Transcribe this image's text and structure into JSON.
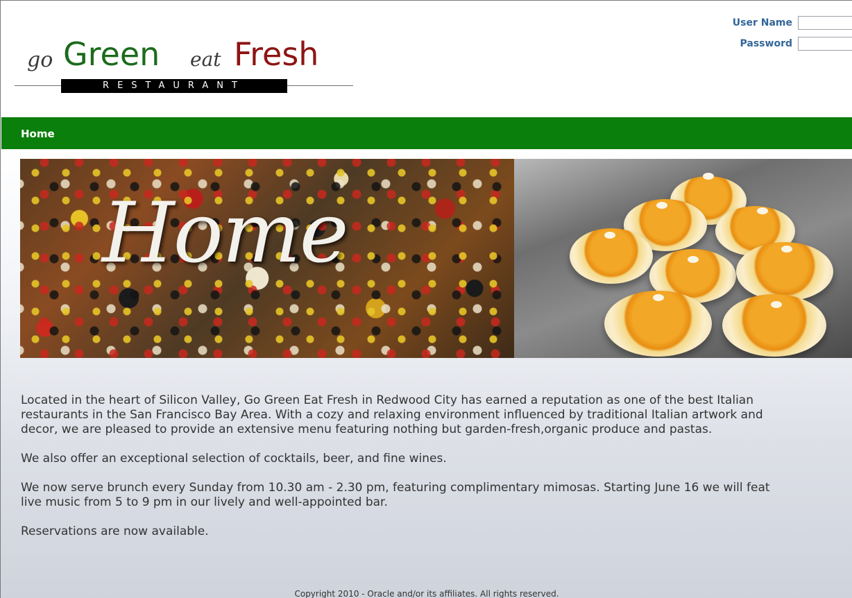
{
  "logo": {
    "go": "go",
    "green": "Green",
    "eat": "eat",
    "fresh": "Fresh",
    "tagline": "RESTAURANT"
  },
  "login": {
    "username_label": "User Name",
    "username_value": "",
    "password_label": "Password",
    "password_value": ""
  },
  "nav": {
    "home": "Home"
  },
  "hero": {
    "title": "Home"
  },
  "content": {
    "paragraphs": [
      [
        "Located in the heart of Silicon Valley, Go Green Eat Fresh in Redwood City has earned a reputation as one of the best Italian",
        "restaurants in the San Francisco Bay Area. With a cozy and relaxing environment influenced by traditional Italian artwork and",
        "decor, we are pleased to provide an extensive menu featuring nothing but garden-fresh,organic produce and pastas."
      ],
      [
        "We also offer an exceptional selection of cocktails, beer, and fine wines."
      ],
      [
        "We now serve brunch every Sunday from 10.30 am - 2.30 pm, featuring complimentary mimosas. Starting June 16 we will feat",
        "live music from 5 to 9 pm in our lively and well-appointed bar."
      ],
      [
        "Reservations are now available."
      ]
    ]
  },
  "footer": {
    "copyright": "Copyright 2010 - Oracle and/or its affiliates. All rights reserved."
  },
  "colors": {
    "nav_green": "#0b7f0b",
    "logo_green": "#1c6b1c",
    "logo_red": "#8e1414",
    "label_blue": "#336699"
  }
}
